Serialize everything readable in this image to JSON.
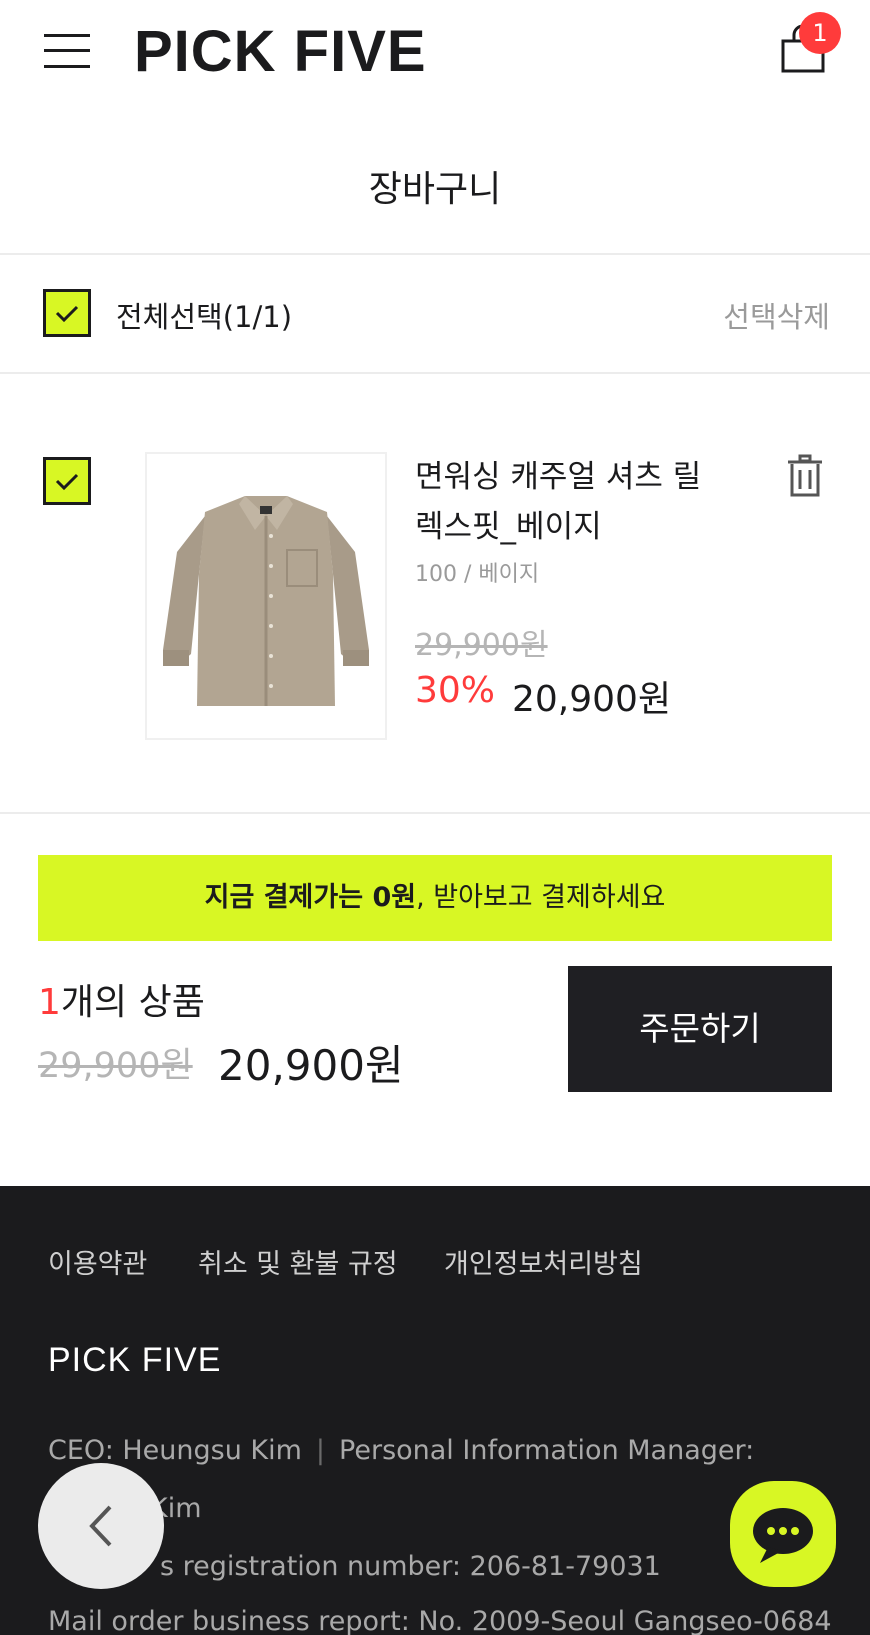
{
  "header": {
    "logo": "PICK FIVE",
    "cart_count": "1"
  },
  "page": {
    "title": "장바구니"
  },
  "select_bar": {
    "select_all_label": "전체선택(1/1)",
    "delete_selected": "선택삭제"
  },
  "cart_item": {
    "name": "면워싱 캐주얼 셔츠 릴렉스핏_베이지",
    "option": "100 / 베이지",
    "original_price": "29,900원",
    "discount_rate": "30%",
    "price": "20,900원",
    "image_icon": "beige-shirt-image"
  },
  "banner": {
    "bold_text": "지금 결제가는 0원",
    "rest_text": ", 받아보고 결제하세요"
  },
  "summary": {
    "count": "1",
    "count_suffix": "개의 상품",
    "original_total": "29,900원",
    "final_total": "20,900원",
    "order_button": "주문하기"
  },
  "footer": {
    "links": [
      "이용약관",
      "취소 및 환불 규정",
      "개인정보처리방침"
    ],
    "brand": "PICK FIVE",
    "ceo": "CEO: Heungsu Kim",
    "privacy_manager": "Personal Information Manager:",
    "privacy_manager_name": "Kim",
    "business_reg": "s registration number: 206-81-79031",
    "mail_order": "Mail order business report: No. 2009-Seoul Gangseo-0684"
  },
  "colors": {
    "accent": "#d8f724",
    "sale_red": "#ff3b3b",
    "dark": "#1b1b1d"
  }
}
